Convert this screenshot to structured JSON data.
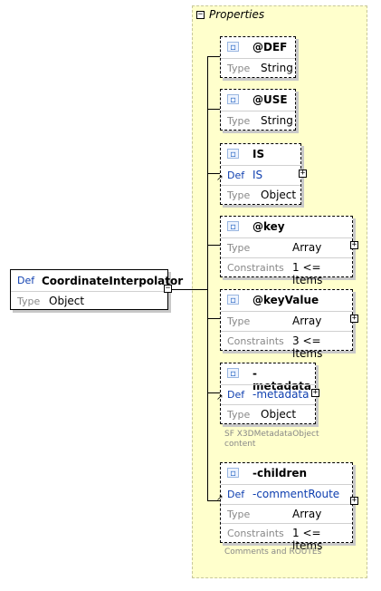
{
  "root": {
    "def_label": "Def",
    "name": "CoordinateInterpolator",
    "type_label": "Type",
    "type_value": "Object"
  },
  "group": {
    "title": "Properties"
  },
  "nodes": [
    {
      "name": "@DEF",
      "type_label": "Type",
      "type_value": "String"
    },
    {
      "name": "@USE",
      "type_label": "Type",
      "type_value": "String"
    },
    {
      "name": "IS",
      "def_label": "Def",
      "def_value": "IS",
      "type_label": "Type",
      "type_value": "Object"
    },
    {
      "name": "@key",
      "type_label": "Type",
      "type_value": "Array",
      "constraints_label": "Constraints",
      "constraints_value": "1 <= items"
    },
    {
      "name": "@keyValue",
      "type_label": "Type",
      "type_value": "Array",
      "constraints_label": "Constraints",
      "constraints_value": "3 <= items"
    },
    {
      "name": "-metadata",
      "def_label": "Def",
      "def_value": "-metadata",
      "type_label": "Type",
      "type_value": "Object",
      "note_line1": "SF X3DMetadataObject",
      "note_line2": "content"
    },
    {
      "name": "-children",
      "def_label": "Def",
      "def_value": "-commentRoute",
      "type_label": "Type",
      "type_value": "Array",
      "constraints_label": "Constraints",
      "constraints_value": "1 <= items",
      "note_line1": "Comments and ROUTEs"
    }
  ],
  "icons": {
    "expand": "plus-box-icon",
    "collapse": "minus-box-icon",
    "element": "element-icon",
    "reference": "reference-arrow-icon"
  }
}
